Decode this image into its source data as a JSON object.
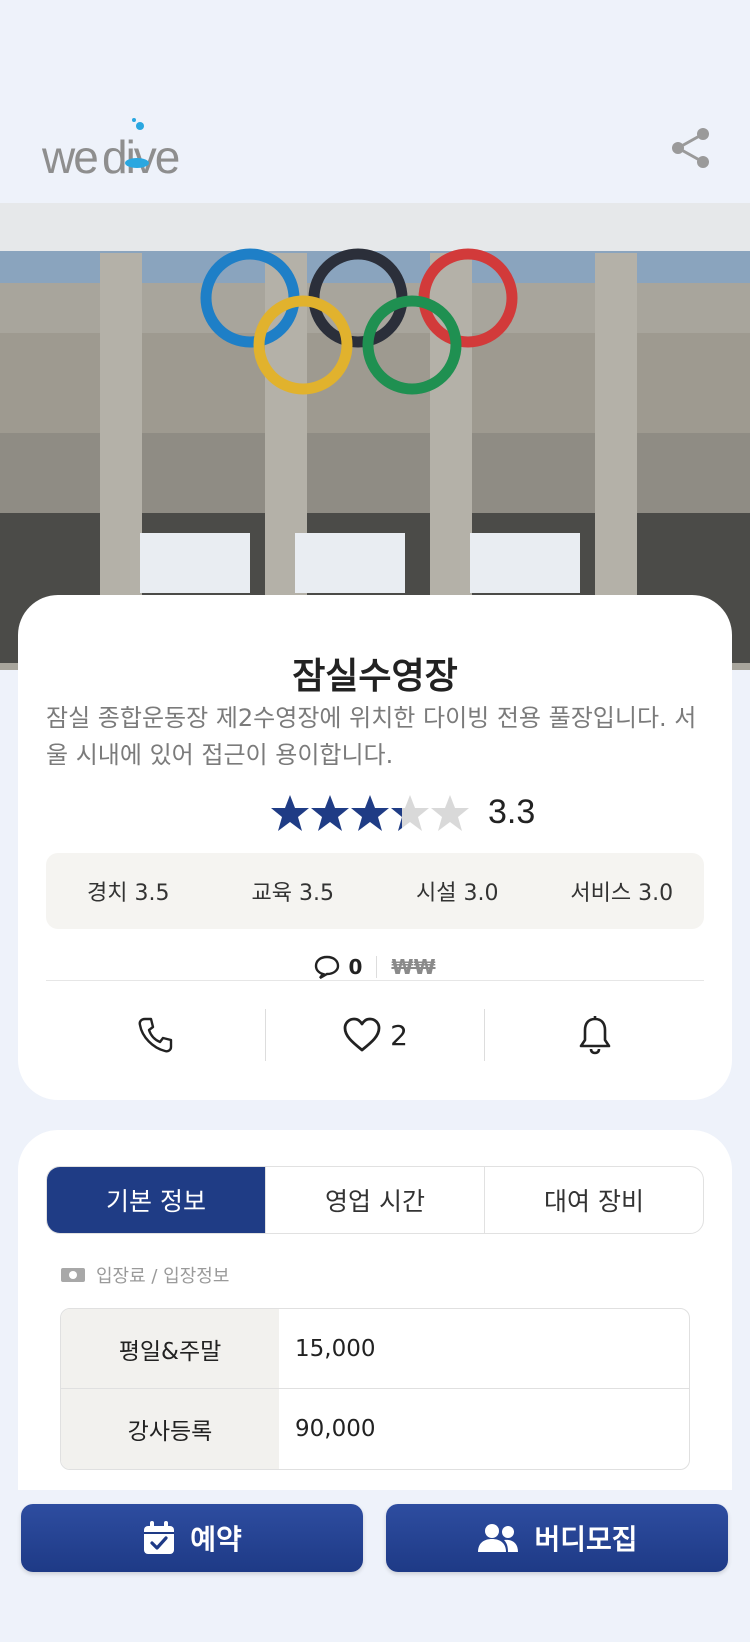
{
  "header": {
    "logo_text": "wedive"
  },
  "venue": {
    "title": "잠실수영장",
    "description": "잠실 종합운동장 제2수영장에 위치한 다이빙 전용 풀장입니다. 서울 시내에 있어 접근이 용이합니다.",
    "rating": "3.3",
    "rating_value": 3.3,
    "sub_ratings": [
      {
        "label": "경치 3.5"
      },
      {
        "label": "교육 3.5"
      },
      {
        "label": "시설 3.0"
      },
      {
        "label": "서비스 3.0"
      }
    ],
    "comment_count": "0",
    "price_level": "₩₩",
    "like_count": "2"
  },
  "tabs": [
    {
      "label": "기본 정보",
      "active": true
    },
    {
      "label": "영업 시간",
      "active": false
    },
    {
      "label": "대여 장비",
      "active": false
    }
  ],
  "fee_section": {
    "label": "입장료 / 입장정보",
    "rows": [
      {
        "name": "평일&주말",
        "value": "15,000"
      },
      {
        "name": "강사등록",
        "value": "90,000"
      }
    ]
  },
  "bottom_buttons": {
    "reserve": "예약",
    "buddy": "버디모집"
  },
  "colors": {
    "primary": "#1f3c85",
    "star_filled": "#1f3c85",
    "star_empty": "#d9d9d9",
    "background": "#eef2fa"
  }
}
